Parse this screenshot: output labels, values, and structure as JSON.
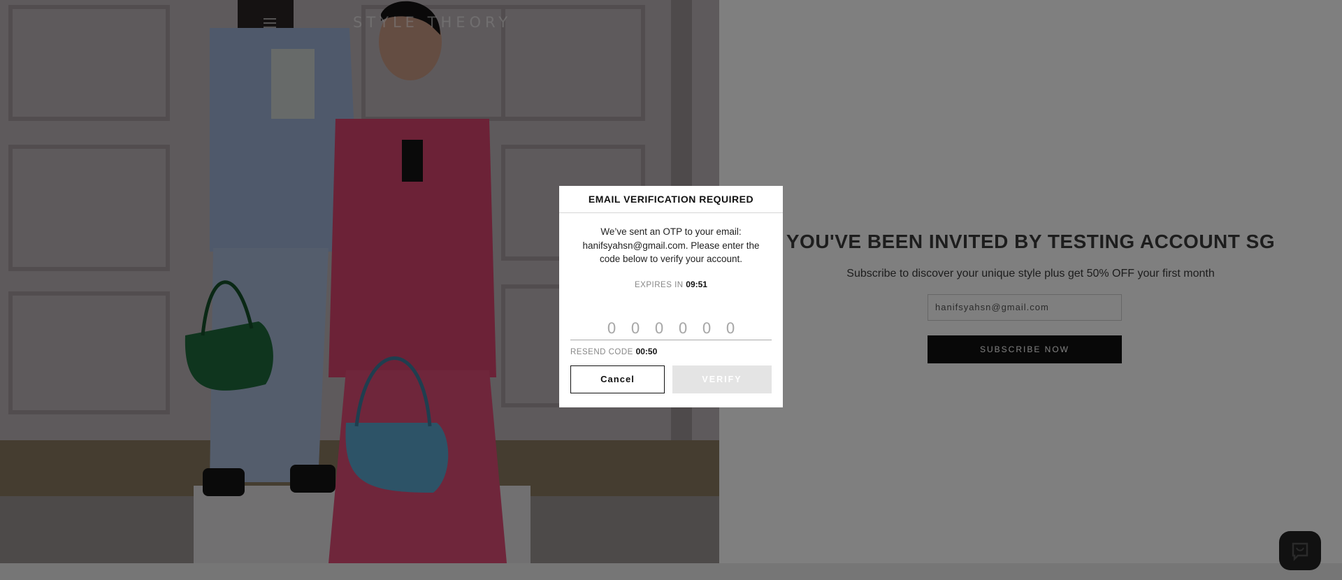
{
  "header": {
    "brand": "STYLE THEORY",
    "menu_icon": "hamburger-menu-icon"
  },
  "landing": {
    "title": "YOU'VE BEEN INVITED BY TESTING ACCOUNT SG",
    "subtitle": "Subscribe to discover your unique style plus get 50% OFF your first month",
    "email_value": "hanifsyahsn@gmail.com",
    "subscribe_label": "SUBSCRIBE NOW"
  },
  "modal": {
    "title": "EMAIL VERIFICATION REQUIRED",
    "message": "We’ve sent an OTP to your email: hanifsyahsn@gmail.com. Please enter the code below to verify your account.",
    "expires_label": "EXPIRES IN",
    "expires_time": "09:51",
    "otp_placeholders": [
      "0",
      "0",
      "0",
      "0",
      "0",
      "0"
    ],
    "resend_label": "RESEND CODE",
    "resend_time": "00:50",
    "cancel_label": "Cancel",
    "verify_label": "VERIFY"
  },
  "chat": {
    "icon": "chat-bubble-icon"
  },
  "colors": {
    "accent": "#111111",
    "pink_suit": "#d9456e",
    "blue_suit": "#9fb2d6",
    "bag_green": "#1e6b3c",
    "bag_blue": "#5aa7cf"
  }
}
